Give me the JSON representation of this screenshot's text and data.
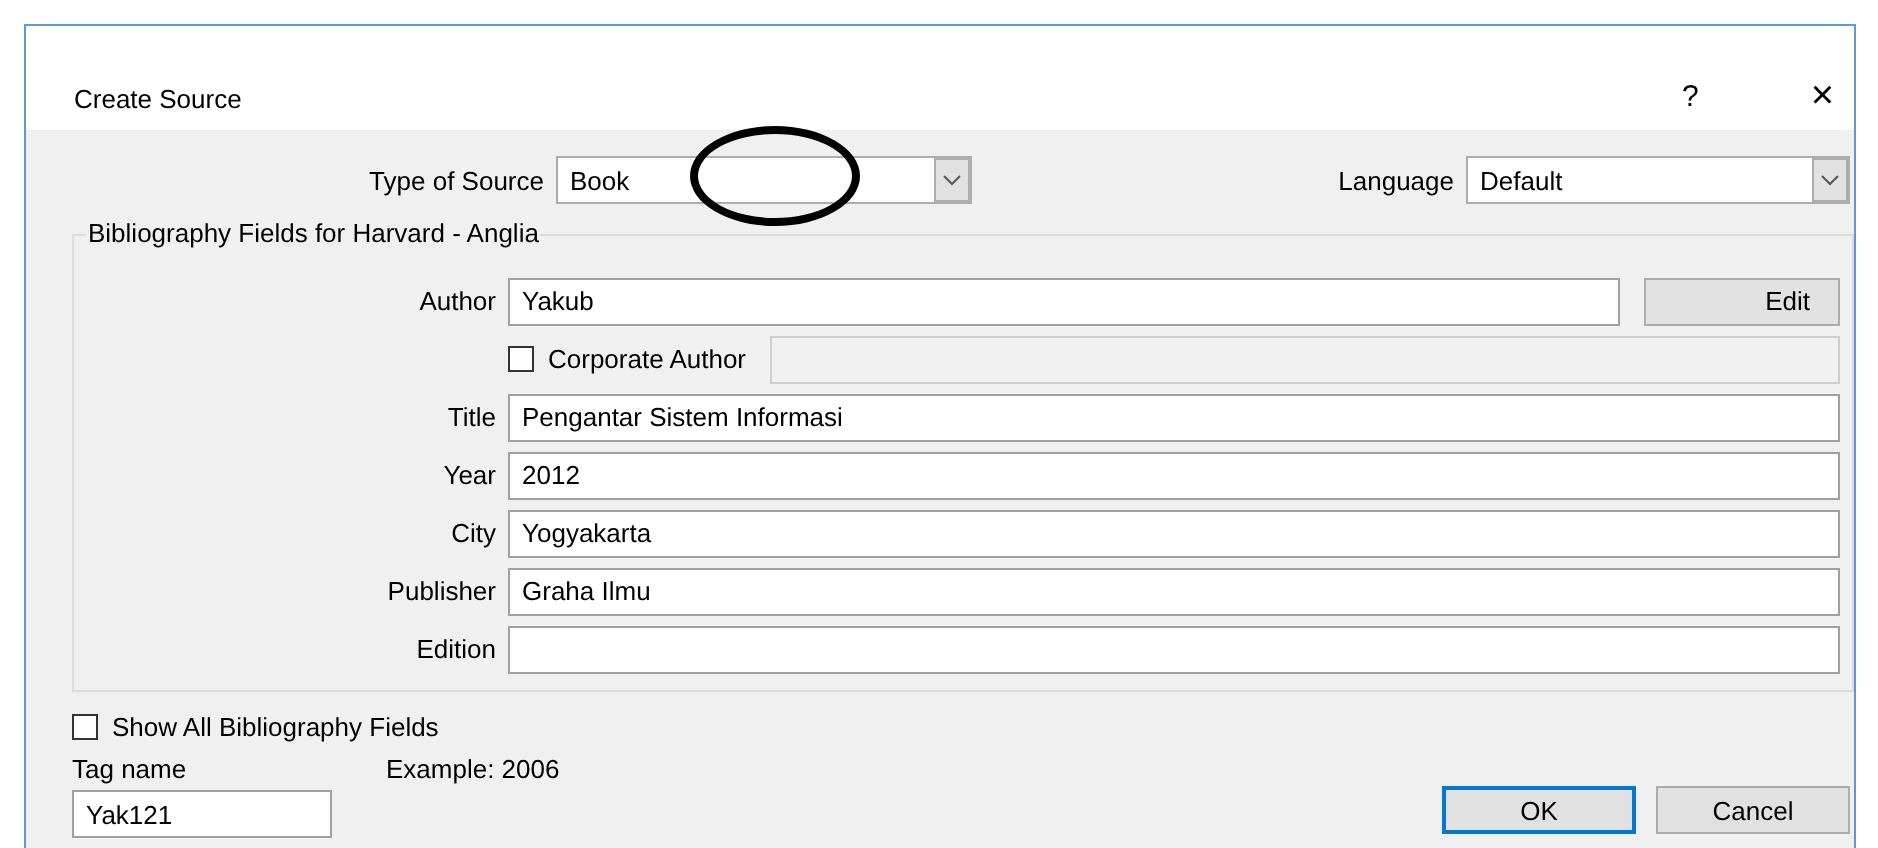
{
  "window": {
    "title": "Create Source",
    "help": "?",
    "close": "×"
  },
  "type_of_source": {
    "label": "Type of Source",
    "value": "Book"
  },
  "language": {
    "label": "Language",
    "value": "Default"
  },
  "group": {
    "legend": "Bibliography Fields for Harvard - Anglia",
    "fields": [
      {
        "kind": "author",
        "label": "Author",
        "value": "Yakub",
        "button": "Edit"
      },
      {
        "kind": "checkbox",
        "label": "Corporate Author",
        "checked": false
      },
      {
        "kind": "text",
        "label": "Title",
        "value": "Pengantar Sistem Informasi"
      },
      {
        "kind": "text",
        "label": "Year",
        "value": "2012"
      },
      {
        "kind": "text",
        "label": "City",
        "value": "Yogyakarta"
      },
      {
        "kind": "text",
        "label": "Publisher",
        "value": "Graha Ilmu"
      },
      {
        "kind": "text",
        "label": "Edition"
      }
    ]
  },
  "show_all": {
    "label": "Show All Bibliography Fields",
    "checked": false
  },
  "tag": {
    "label": "Tag name",
    "value": "Yak121",
    "example": "Example: 2006"
  },
  "buttons": [
    {
      "label": "OK",
      "default": true
    },
    {
      "label": "Cancel",
      "default": false
    }
  ]
}
